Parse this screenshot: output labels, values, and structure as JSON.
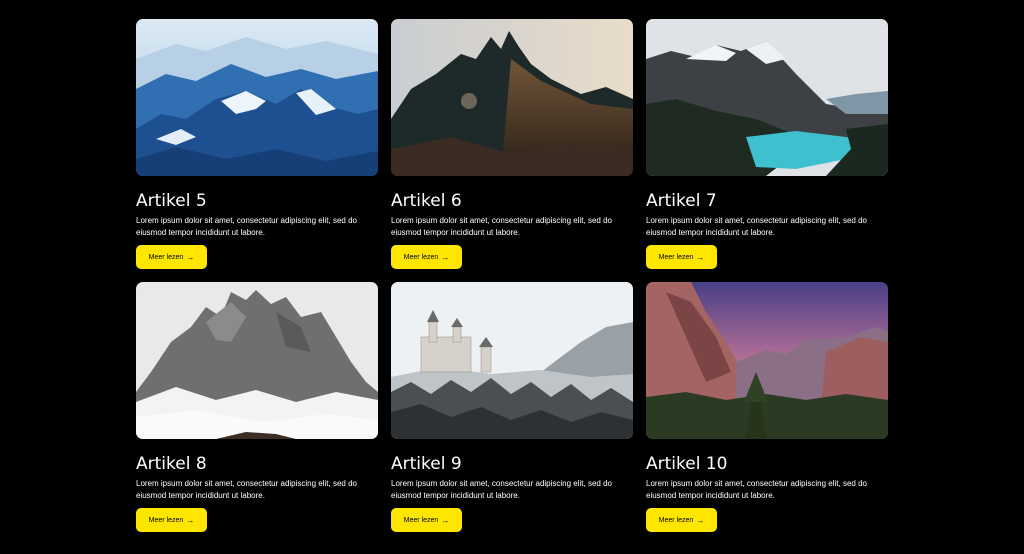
{
  "colors": {
    "background": "#000000",
    "button": "#FFE600",
    "title": "#FFFFFF",
    "text": "#FFFFFF"
  },
  "articles": [
    {
      "title": "Artikel 5",
      "excerpt": "Lorem ipsum dolor sit amet, consectetur adipiscing elit, sed do eiusmod tempor incididunt ut labore.",
      "button_label": "Meer lezen",
      "button_icon": "arrow-right-icon",
      "image": "blue-snowy-mountain-range"
    },
    {
      "title": "Artikel 6",
      "excerpt": "Lorem ipsum dolor sit amet, consectetur adipiscing elit, sed do eiusmod tempor incididunt ut labore.",
      "button_label": "Meer lezen",
      "button_icon": "arrow-right-icon",
      "image": "dark-jagged-peaks-sunset"
    },
    {
      "title": "Artikel 7",
      "excerpt": "Lorem ipsum dolor sit amet, consectetur adipiscing elit, sed do eiusmod tempor incididunt ut labore.",
      "button_label": "Meer lezen",
      "button_icon": "arrow-right-icon",
      "image": "turquoise-mountain-lake"
    },
    {
      "title": "Artikel 8",
      "excerpt": "Lorem ipsum dolor sit amet, consectetur adipiscing elit, sed do eiusmod tempor incididunt ut labore.",
      "button_label": "Meer lezen",
      "button_icon": "arrow-right-icon",
      "image": "misty-rocky-peak"
    },
    {
      "title": "Artikel 9",
      "excerpt": "Lorem ipsum dolor sit amet, consectetur adipiscing elit, sed do eiusmod tempor incididunt ut labore.",
      "button_label": "Meer lezen",
      "button_icon": "arrow-right-icon",
      "image": "snowy-castle-forest"
    },
    {
      "title": "Artikel 10",
      "excerpt": "Lorem ipsum dolor sit amet, consectetur adipiscing elit, sed do eiusmod tempor incididunt ut labore.",
      "button_label": "Meer lezen",
      "button_icon": "arrow-right-icon",
      "image": "valley-cliffs-pink-sky"
    }
  ]
}
